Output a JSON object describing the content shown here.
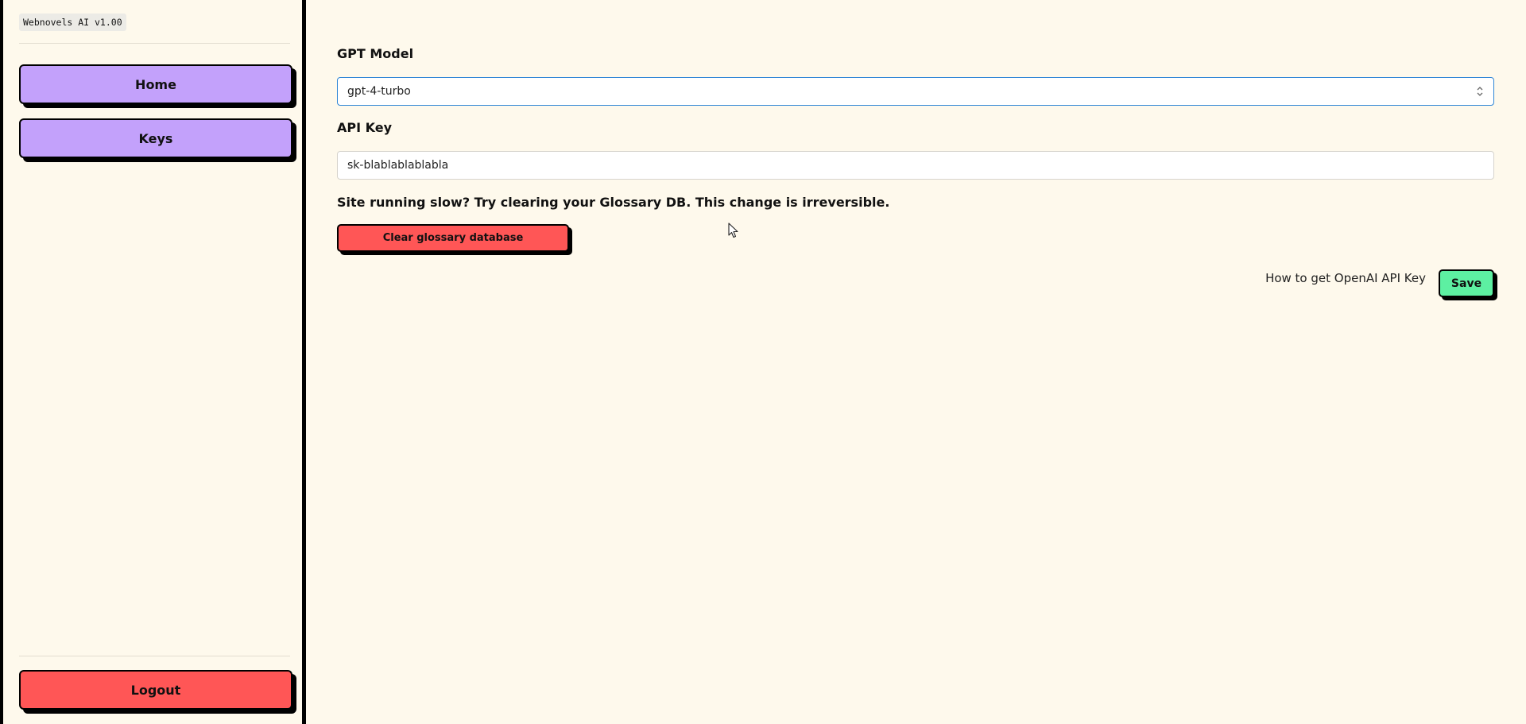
{
  "sidebar": {
    "version": "Webnovels AI v1.00",
    "nav": [
      {
        "label": "Home"
      },
      {
        "label": "Keys"
      }
    ],
    "logout_label": "Logout"
  },
  "settings": {
    "gpt_model_label": "GPT Model",
    "gpt_model_value": "gpt-4-turbo",
    "api_key_label": "API Key",
    "api_key_value": "sk-blablablablabla",
    "warning_text": "Site running slow? Try clearing your Glossary DB. This change is irreversible.",
    "clear_button_label": "Clear glossary database",
    "howto_link_label": "How to get OpenAI API Key",
    "save_button_label": "Save"
  },
  "colors": {
    "background": "#fef9ec",
    "nav_purple": "#c3a1fb",
    "danger_red": "#ff5656",
    "save_green": "#5df0a2",
    "focus_blue": "#2f86d6"
  },
  "icons": {
    "select_chevron": "chevron-up-down-icon",
    "cursor": "mouse-pointer-icon"
  }
}
